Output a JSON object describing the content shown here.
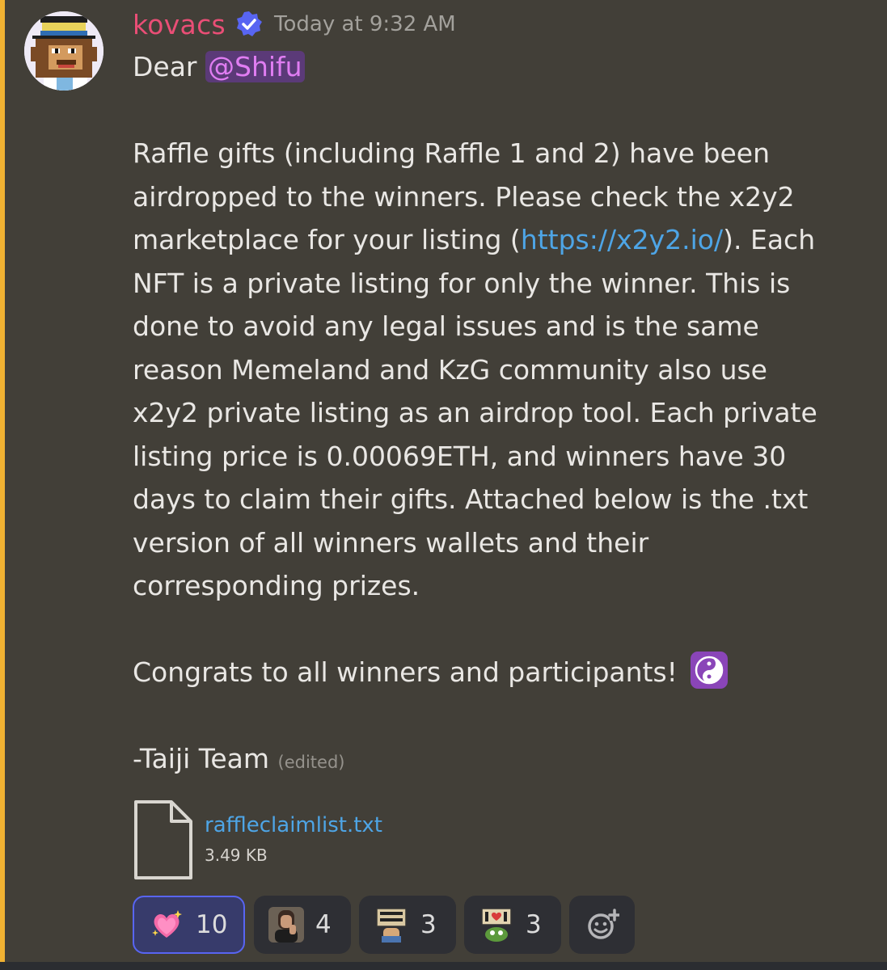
{
  "message": {
    "author": "kovacs",
    "timestamp": "Today at 9:32 AM",
    "greeting": "Dear ",
    "mention": "@Shifu",
    "paragraph_before_link": "Raffle gifts (including Raffle 1 and 2) have been\nairdropped to the winners. Please check the x2y2\nmarketplace for your listing (",
    "link_text": "https://x2y2.io/",
    "paragraph_after_link": "). Each\nNFT is a private listing for only the winner. This is\ndone to avoid any legal issues and is the same\nreason Memeland and KzG community also use\nx2y2 private listing as an airdrop tool. Each private\nlisting price is 0.00069ETH, and winners have 30\ndays to claim their gifts. Attached below is the .txt\nversion of all winners wallets and their\ncorresponding prizes.",
    "congrats": "Congrats to all winners and participants! ",
    "congrats_emoji": "yin-yang-emoji",
    "signature": "-Taiji Team",
    "edited_label": "(edited)"
  },
  "attachment": {
    "filename": "raffleclaimlist.txt",
    "size": "3.49 KB",
    "icon": "file-icon"
  },
  "reactions": [
    {
      "emoji": "sparkling-heart-emoji",
      "count": "10",
      "selected": true
    },
    {
      "emoji": "custom-person-emoji",
      "count": "4",
      "selected": false
    },
    {
      "emoji": "stay-zen-emoji",
      "count": "3",
      "selected": false
    },
    {
      "emoji": "i-heart-u-emoji",
      "count": "3",
      "selected": false
    }
  ],
  "add_reaction_icon": "add-reaction-icon",
  "colors": {
    "username": "#ea4e76",
    "mention_bg": "#5b3a78",
    "link": "#4ea5e6",
    "accent_bar": "#f0b132",
    "reaction_selected_border": "#5865f2"
  }
}
